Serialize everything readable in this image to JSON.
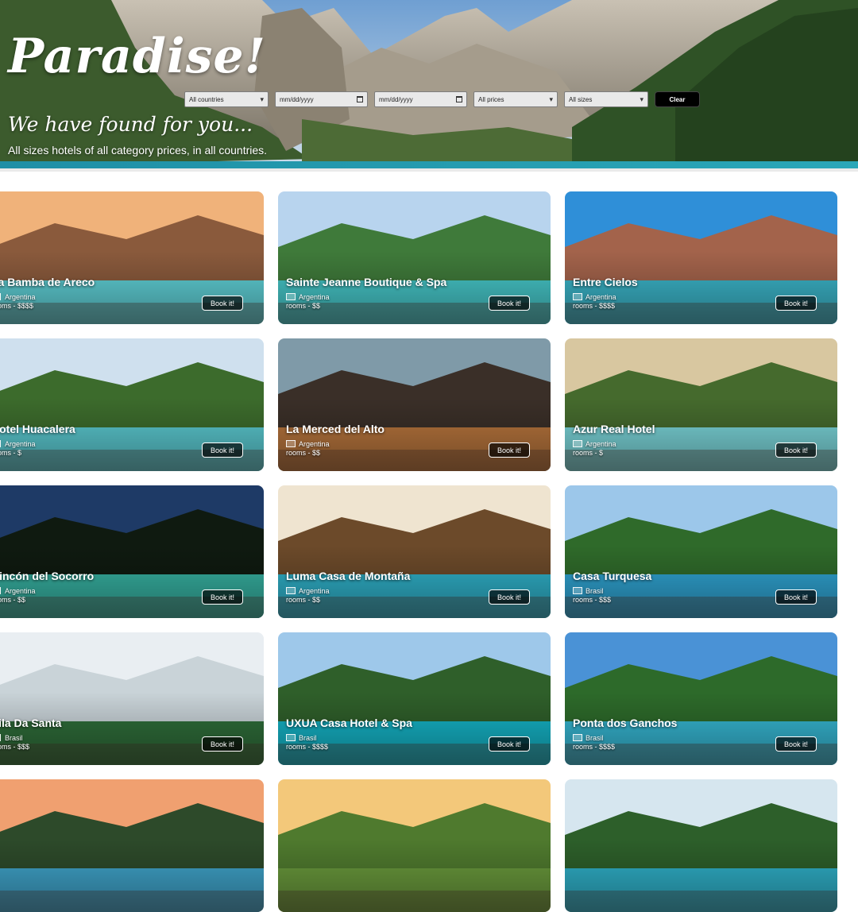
{
  "hero": {
    "brand": "Paradise!",
    "subtitle": "We have found for you...",
    "tagline": "All sizes hotels of all category prices, in all countries."
  },
  "filters": {
    "country": "All countries",
    "date_from": "mm/dd/yyyy",
    "date_to": "mm/dd/yyyy",
    "price": "All prices",
    "size": "All sizes",
    "clear": "Clear"
  },
  "icons": {
    "caret": "chevron-down-icon",
    "calendar": "calendar-icon",
    "flag": "flag-icon"
  },
  "book_label": "Book it!",
  "flag_alt": "Flag",
  "hotels": [
    {
      "name": "La Bamba de Areco",
      "country": "Argentina",
      "meta": "rooms -  $$$$"
    },
    {
      "name": "Sainte Jeanne Boutique & Spa",
      "country": "Argentina",
      "meta": "rooms -  $$"
    },
    {
      "name": "Entre Cielos",
      "country": "Argentina",
      "meta": "rooms -  $$$$"
    },
    {
      "name": "Hotel Huacalera",
      "country": "Argentina",
      "meta": "rooms -  $"
    },
    {
      "name": "La Merced del Alto",
      "country": "Argentina",
      "meta": "rooms -  $$"
    },
    {
      "name": "Azur Real Hotel",
      "country": "Argentina",
      "meta": "rooms -  $"
    },
    {
      "name": "Rincón del Socorro",
      "country": "Argentina",
      "meta": "rooms -  $$"
    },
    {
      "name": "Luma Casa de Montaña",
      "country": "Argentina",
      "meta": "rooms -  $$"
    },
    {
      "name": "Casa Turquesa",
      "country": "Brasil",
      "meta": "rooms -  $$$"
    },
    {
      "name": "Vila Da Santa",
      "country": "Brasil",
      "meta": "rooms -  $$$"
    },
    {
      "name": "UXUA Casa Hotel & Spa",
      "country": "Brasil",
      "meta": "rooms -  $$$$"
    },
    {
      "name": "Ponta dos Ganchos",
      "country": "Brasil",
      "meta": "rooms -  $$$$"
    },
    {
      "name": "",
      "country": "",
      "meta": ""
    },
    {
      "name": "",
      "country": "",
      "meta": ""
    },
    {
      "name": "",
      "country": "",
      "meta": ""
    }
  ]
}
